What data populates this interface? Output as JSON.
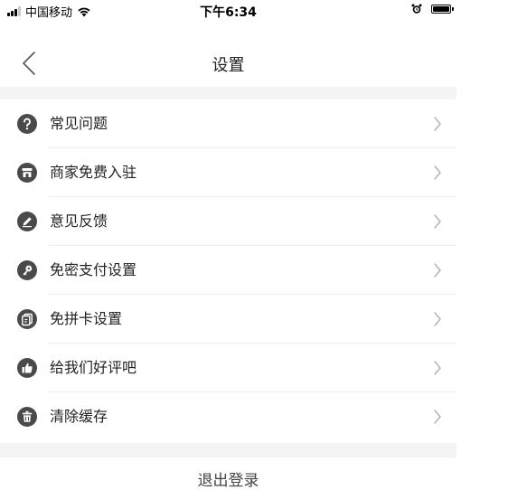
{
  "status_bar": {
    "carrier": "中国移动",
    "time": "下午6:34",
    "icons": [
      "signal-icon",
      "wifi-icon",
      "alarm-icon",
      "battery-icon"
    ]
  },
  "nav": {
    "title": "设置",
    "back_icon": "chevron-left-icon"
  },
  "menu": {
    "items": [
      {
        "label": "常见问题",
        "icon": "question-icon"
      },
      {
        "label": "商家免费入驻",
        "icon": "store-icon"
      },
      {
        "label": "意见反馈",
        "icon": "edit-icon"
      },
      {
        "label": "免密支付设置",
        "icon": "key-icon"
      },
      {
        "label": "免拼卡设置",
        "icon": "card-icon"
      },
      {
        "label": "给我们好评吧",
        "icon": "thumbs-up-icon"
      },
      {
        "label": "清除缓存",
        "icon": "trash-icon"
      }
    ],
    "chevron_icon": "chevron-right-icon"
  },
  "logout": {
    "label": "退出登录"
  },
  "colors": {
    "icon": "#4a4a4a",
    "divider": "#ececec",
    "section_gap": "#f4f4f4",
    "chevron": "#b0b0b0"
  }
}
